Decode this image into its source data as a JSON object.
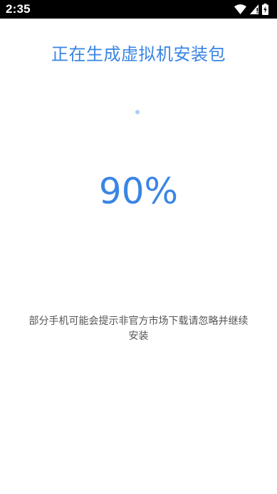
{
  "status_bar": {
    "time": "2:35",
    "icons": [
      "wifi-icon",
      "cellular-signal-icon",
      "battery-charging-icon"
    ]
  },
  "main": {
    "title": "正在生成虚拟机安装包",
    "progress_percent_text": "90%",
    "progress_value": 90,
    "notice": "部分手机可能会提示非官方市场下载请忽略并继续安装"
  },
  "colors": {
    "accent": "#3a85e4",
    "spinner": "#a9cdf7",
    "notice_text": "#555555",
    "status_bar_bg": "#000000",
    "background": "#ffffff"
  }
}
